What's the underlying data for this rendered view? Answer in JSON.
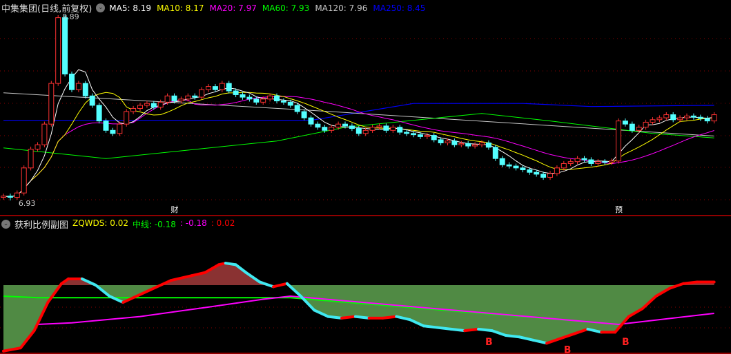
{
  "header": {
    "title": "中集集团(日线,前复权)",
    "dropdown_icon": "chevron-down-icon",
    "ma": [
      {
        "label": "MA5: 8.19",
        "color": "#ffffff"
      },
      {
        "label": "MA10: 8.17",
        "color": "#ffff00"
      },
      {
        "label": "MA20: 7.97",
        "color": "#ff00ff"
      },
      {
        "label": "MA60: 7.93",
        "color": "#00ff00"
      },
      {
        "label": "MA120: 7.96",
        "color": "#c8c8c8"
      },
      {
        "label": "MA250: 8.45",
        "color": "#0000ff"
      }
    ]
  },
  "main_chart": {
    "max_label": "9.89",
    "min_label": "6.93",
    "markers": [
      {
        "text": "财",
        "bar": 25
      },
      {
        "text": "预",
        "bar": 90
      }
    ],
    "up_color": "#ff3232",
    "down_color": "#54ffff",
    "peak_high": 9.89,
    "trough_low": 6.93,
    "closes": [
      7.0,
      6.98,
      7.05,
      7.45,
      7.75,
      7.82,
      8.15,
      8.8,
      9.85,
      8.95,
      8.7,
      8.8,
      8.6,
      8.45,
      8.2,
      8.05,
      8.0,
      8.15,
      8.35,
      8.4,
      8.45,
      8.48,
      8.42,
      8.5,
      8.6,
      8.52,
      8.55,
      8.6,
      8.58,
      8.7,
      8.75,
      8.7,
      8.8,
      8.68,
      8.62,
      8.58,
      8.55,
      8.5,
      8.55,
      8.6,
      8.52,
      8.5,
      8.45,
      8.35,
      8.25,
      8.15,
      8.1,
      8.05,
      8.1,
      8.15,
      8.12,
      8.08,
      8.0,
      8.05,
      8.1,
      8.12,
      8.05,
      8.1,
      8.02,
      8.0,
      7.98,
      7.95,
      7.97,
      7.9,
      7.85,
      7.88,
      7.82,
      7.84,
      7.8,
      7.82,
      7.85,
      7.78,
      7.6,
      7.5,
      7.48,
      7.45,
      7.42,
      7.38,
      7.35,
      7.3,
      7.36,
      7.45,
      7.52,
      7.55,
      7.6,
      7.58,
      7.52,
      7.55,
      7.54,
      7.56,
      8.2,
      8.15,
      8.05,
      8.1,
      8.18,
      8.22,
      8.25,
      8.3,
      8.22,
      8.25,
      8.28,
      8.26,
      8.24,
      8.2,
      8.3
    ],
    "ma60": [
      [
        0,
        7.77
      ],
      [
        15,
        7.6
      ],
      [
        40,
        7.88
      ],
      [
        50,
        8.1
      ],
      [
        70,
        8.32
      ],
      [
        80,
        8.2
      ],
      [
        95,
        8.0
      ],
      [
        104,
        7.93
      ]
    ],
    "ma120": [
      [
        0,
        8.65
      ],
      [
        45,
        8.37
      ],
      [
        104,
        7.96
      ]
    ],
    "ma250": [
      [
        0,
        8.21
      ],
      [
        45,
        8.21
      ],
      [
        60,
        8.48
      ],
      [
        76,
        8.48
      ],
      [
        86,
        8.43
      ],
      [
        104,
        8.45
      ]
    ]
  },
  "sub_chart": {
    "title": "获利比例副图",
    "legend": [
      {
        "label": "ZQWDS: 0.02",
        "color": "#ffff00"
      },
      {
        "label": "中线: -0.18",
        "color": "#00ff00"
      },
      {
        "label": ": -0.18",
        "color": "#ff00ff"
      },
      {
        "label": ": 0.02",
        "color": "#ff0000"
      }
    ],
    "zqwds": [
      [
        0,
        -0.42
      ],
      [
        2.5,
        -0.4
      ],
      [
        4.5,
        -0.29
      ],
      [
        6.5,
        -0.11
      ],
      [
        8.5,
        0.01
      ],
      [
        9.5,
        0.04
      ],
      [
        11.5,
        0.04
      ],
      [
        13.5,
        0.0
      ],
      [
        15.5,
        -0.07
      ],
      [
        17.5,
        -0.11
      ],
      [
        19.5,
        -0.07
      ],
      [
        21.5,
        -0.03
      ],
      [
        24.5,
        0.03
      ],
      [
        27.5,
        0.06
      ],
      [
        29.5,
        0.08
      ],
      [
        31.5,
        0.13
      ],
      [
        32.5,
        0.14
      ],
      [
        34,
        0.13
      ],
      [
        35.5,
        0.08
      ],
      [
        37.5,
        0.02
      ],
      [
        39.5,
        -0.01
      ],
      [
        41.5,
        0.01
      ],
      [
        43.5,
        -0.07
      ],
      [
        45.5,
        -0.16
      ],
      [
        47.5,
        -0.2
      ],
      [
        49.5,
        -0.21
      ],
      [
        51.5,
        -0.2
      ],
      [
        53.5,
        -0.21
      ],
      [
        55.5,
        -0.21
      ],
      [
        57.5,
        -0.2
      ],
      [
        59.5,
        -0.22
      ],
      [
        61.5,
        -0.26
      ],
      [
        63.5,
        -0.27
      ],
      [
        65.5,
        -0.28
      ],
      [
        67.5,
        -0.29
      ],
      [
        69.5,
        -0.28
      ],
      [
        71.5,
        -0.29
      ],
      [
        73.5,
        -0.32
      ],
      [
        75.5,
        -0.33
      ],
      [
        77.5,
        -0.35
      ],
      [
        79.5,
        -0.37
      ],
      [
        81.5,
        -0.34
      ],
      [
        83.5,
        -0.31
      ],
      [
        85.5,
        -0.28
      ],
      [
        87.5,
        -0.3
      ],
      [
        89.5,
        -0.3
      ],
      [
        91.5,
        -0.2
      ],
      [
        93.5,
        -0.15
      ],
      [
        95.5,
        -0.07
      ],
      [
        97.5,
        -0.02
      ],
      [
        99.5,
        0.01
      ],
      [
        101.5,
        0.02
      ],
      [
        104,
        0.02
      ]
    ],
    "midline": [
      [
        0,
        -0.07
      ],
      [
        5,
        -0.08
      ],
      [
        42,
        -0.08
      ],
      [
        90,
        -0.25
      ]
    ],
    "magenta": [
      [
        5,
        -0.25
      ],
      [
        10,
        -0.24
      ],
      [
        20,
        -0.2
      ],
      [
        30,
        -0.14
      ],
      [
        38,
        -0.09
      ],
      [
        42,
        -0.07
      ],
      [
        90,
        -0.25
      ],
      [
        104,
        -0.18
      ]
    ],
    "buy_signals": [
      {
        "text": "B",
        "bar": 70.5,
        "value": -0.32
      },
      {
        "text": "B",
        "bar": 82,
        "value": -0.37
      },
      {
        "text": "B",
        "bar": 90.5,
        "value": -0.32
      }
    ]
  }
}
